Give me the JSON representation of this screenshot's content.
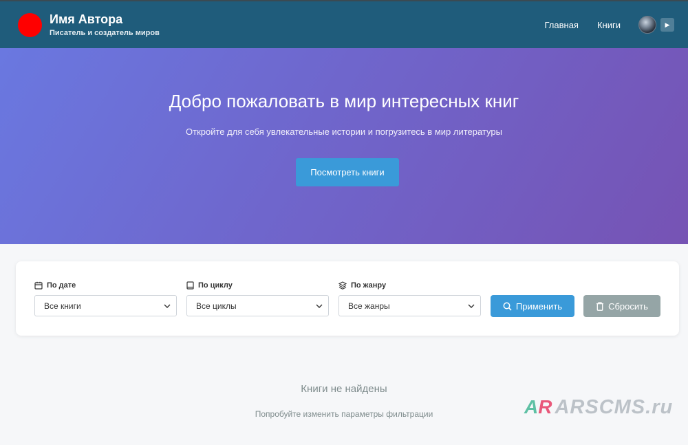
{
  "header": {
    "brand_name": "Имя Автора",
    "brand_subtitle": "Писатель и создатель миров",
    "nav": [
      "Главная",
      "Книги"
    ],
    "logo_color": "#ff0000",
    "bg_color": "#1f5c7b"
  },
  "hero": {
    "title": "Добро пожаловать в мир интересных книг",
    "subtitle": "Откройте для себя увлекательные истории и погрузитесь в мир литературы",
    "button_label": "Посмотреть книги"
  },
  "filters": {
    "date": {
      "label": "По дате",
      "icon": "calendar-icon",
      "value": "Все книги"
    },
    "series": {
      "label": "По циклу",
      "icon": "book-icon",
      "value": "Все циклы"
    },
    "genre": {
      "label": "По жанру",
      "icon": "layers-icon",
      "value": "Все жанры"
    },
    "apply_label": "Применить",
    "reset_label": "Сбросить",
    "accent_color": "#3a9ad9",
    "reset_color": "#95a5a6"
  },
  "empty": {
    "title": "Книги не найдены",
    "subtitle": "Попробуйте изменить параметры фильтрации"
  },
  "watermark": {
    "mark_a": "A",
    "mark_r": "R",
    "text": "ARSCMS.ru"
  }
}
